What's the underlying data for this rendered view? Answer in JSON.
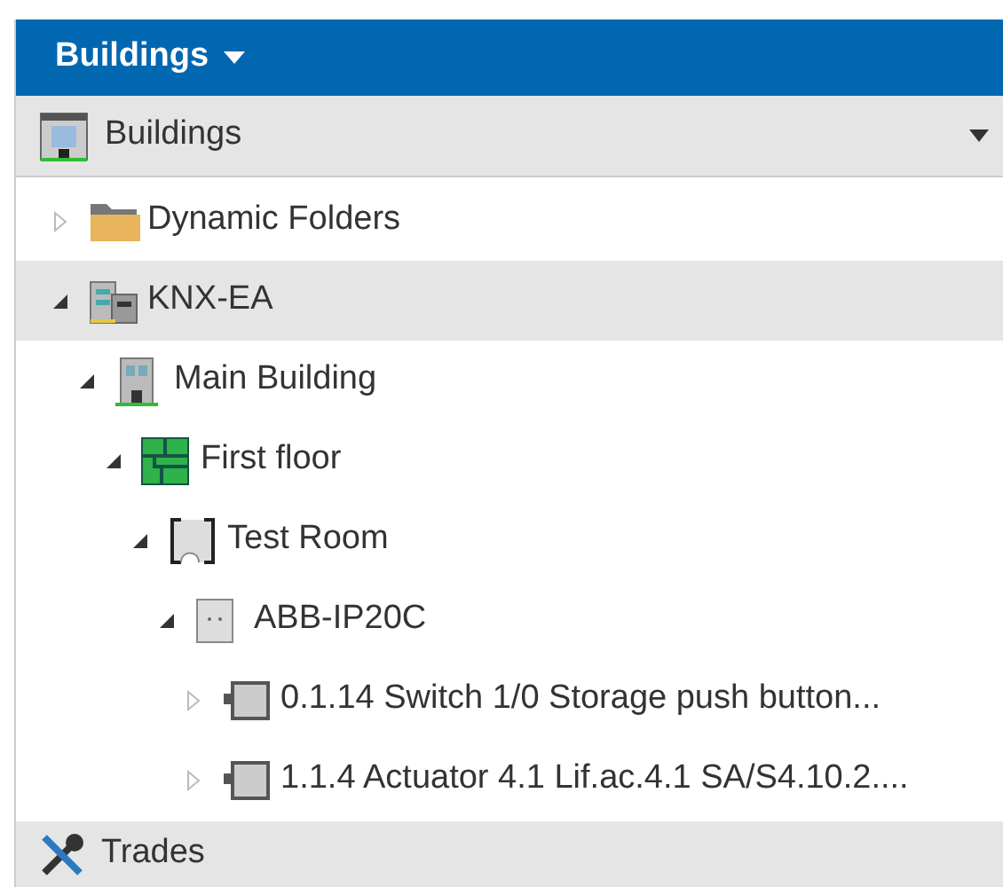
{
  "top_bar": {
    "title": "Buildings"
  },
  "panel": {
    "title": "Buildings"
  },
  "tree": [
    {
      "label": "Dynamic Folders",
      "kind": "folder",
      "expanded": false,
      "selected": false
    },
    {
      "label": "KNX-EA",
      "kind": "project",
      "expanded": true,
      "selected": true,
      "children": [
        {
          "label": "Main Building",
          "kind": "building",
          "expanded": true,
          "selected": false,
          "children": [
            {
              "label": "First floor",
              "kind": "floor",
              "expanded": true,
              "selected": false,
              "children": [
                {
                  "label": "Test Room",
                  "kind": "room",
                  "expanded": true,
                  "selected": false,
                  "children": [
                    {
                      "label": "ABB-IP20C",
                      "kind": "cabinet",
                      "expanded": true,
                      "selected": false,
                      "children": [
                        {
                          "label": "0.1.14 Switch 1/0 Storage push button...",
                          "kind": "device",
                          "expanded": false,
                          "selected": false
                        },
                        {
                          "label": "1.1.4 Actuator 4.1 Lif.ac.4.1 SA/S4.10.2....",
                          "kind": "device",
                          "expanded": false,
                          "selected": false
                        }
                      ]
                    }
                  ]
                }
              ]
            }
          ]
        }
      ]
    }
  ],
  "footer_panel": {
    "title": "Trades"
  }
}
